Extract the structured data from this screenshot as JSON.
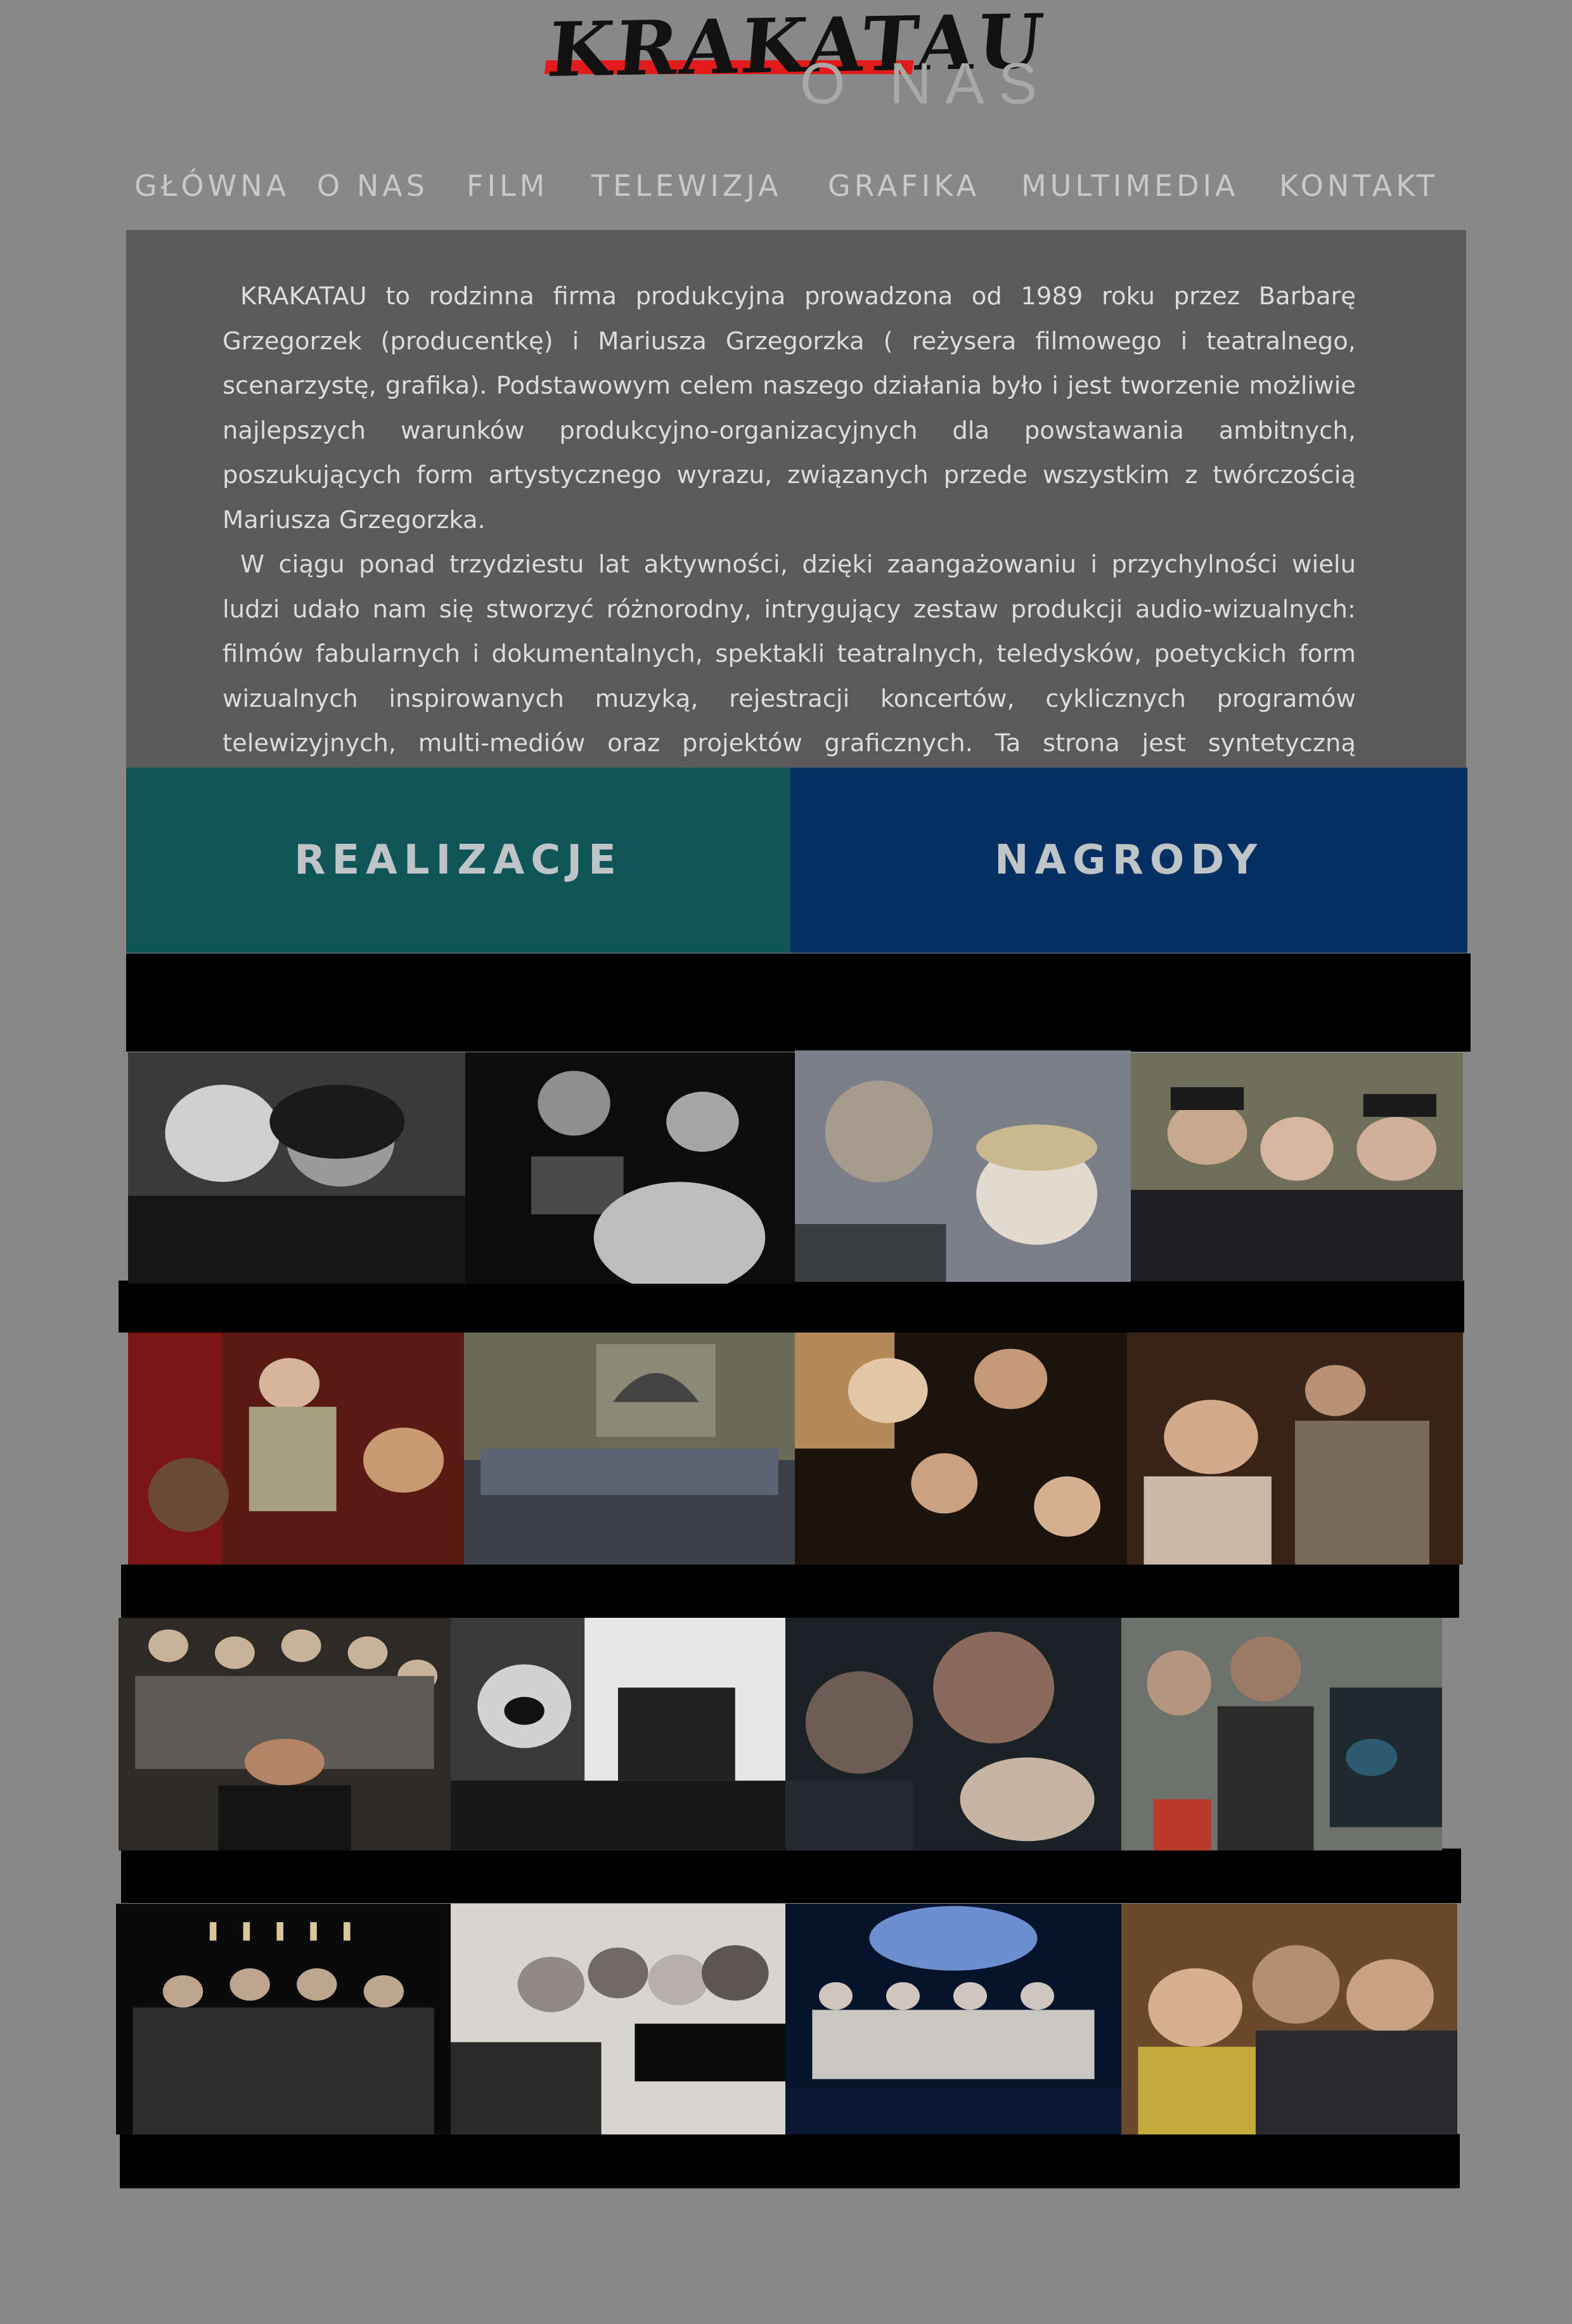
{
  "logo": {
    "text": "KRAKATAU"
  },
  "page_title": "O NAS",
  "nav": {
    "items": [
      {
        "label": "GŁÓWNA"
      },
      {
        "label": "O NAS"
      },
      {
        "label": "FILM"
      },
      {
        "label": "TELEWIZJA"
      },
      {
        "label": "GRAFIKA"
      },
      {
        "label": "MULTIMEDIA"
      },
      {
        "label": "KONTAKT"
      }
    ]
  },
  "about": {
    "paragraphs": [
      "KRAKATAU to rodzinna firma produkcyjna prowadzona od 1989 roku przez Barbarę Grzegorzek (producentkę)  i Mariusza Grzegorzka ( reżysera filmowego i teatralnego, scenarzystę, grafika). Podstawowym celem naszego działania było i  jest tworzenie możliwie najlepszych warunków produkcyjno-organizacyjnych dla powstawania ambitnych, poszukujących form artystycznego wyrazu, związanych przede wszystkim z twórczością Mariusza Grzegorzka.",
      "W  ciągu ponad trzydziestu lat aktywności, dzięki zaangażowaniu i przychylności wielu ludzi udało nam się stworzyć różnorodny, intrygujący zestaw produkcji audio-wizualnych: filmów fabularnych i dokumentalnych, spektakli teatralnych, teledysków, poetyckich form wizualnych inspirowanych muzyką, rejestracji koncertów, cyklicznych programów telewizyjnych, multi-mediów oraz projektów graficznych. Ta strona jest syntetyczną dokumentacją naszego dorobku."
    ]
  },
  "buttons": {
    "realizacje": "REALIZACJE",
    "nagrody": "NAGRODY"
  },
  "colors": {
    "background": "#888888",
    "panel": "#5a5a5a",
    "realizacje_bg": "#0f5558",
    "nagrody_bg": "#053063",
    "logo_accent": "#e21b1b"
  },
  "gallery": {
    "rows": 4,
    "columns": 4,
    "tile_icons": "photo-icon"
  }
}
